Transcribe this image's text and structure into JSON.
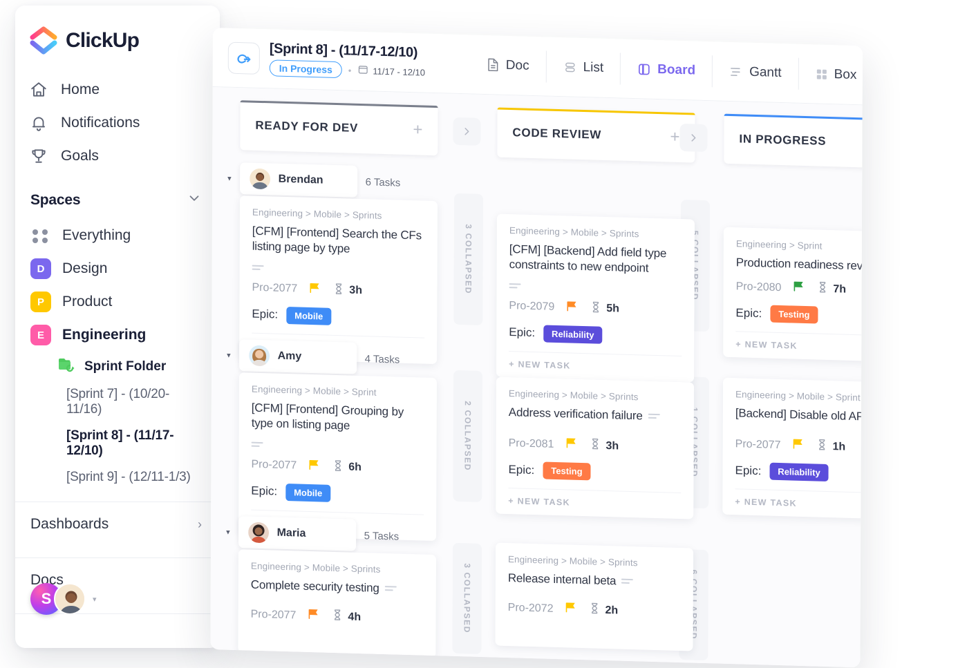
{
  "brand": {
    "name": "ClickUp",
    "accent": "#7b68ee"
  },
  "sidebar": {
    "nav": [
      {
        "label": "Home",
        "icon": "home-icon"
      },
      {
        "label": "Notifications",
        "icon": "bell-icon"
      },
      {
        "label": "Goals",
        "icon": "trophy-icon"
      }
    ],
    "spaces_title": "Spaces",
    "spaces": [
      {
        "label": "Everything",
        "badge": "",
        "color": "",
        "icon": "grid-dots-icon",
        "active": false
      },
      {
        "label": "Design",
        "badge": "D",
        "color": "#7b68ee",
        "active": false
      },
      {
        "label": "Product",
        "badge": "P",
        "color": "#ffc800",
        "active": false
      },
      {
        "label": "Engineering",
        "badge": "E",
        "color": "#ff5ca8",
        "active": true
      }
    ],
    "folder": {
      "label": "Sprint Folder",
      "icon": "folder-sprint-icon"
    },
    "sprints": [
      {
        "label": "[Sprint 7] - (10/20-11/16)",
        "active": false
      },
      {
        "label": "[Sprint 8] - (11/17-12/10)",
        "active": true
      },
      {
        "label": "[Sprint 9] - (12/11-1/3)",
        "active": false
      }
    ],
    "footer_rows": [
      {
        "label": "Dashboards",
        "chevron": "›"
      },
      {
        "label": "Docs",
        "chevron": ""
      }
    ],
    "user_dock": {
      "workspace_initial": "S",
      "caret": "▾"
    }
  },
  "header": {
    "sprint_icon": "sprint-arrow-icon",
    "title": "[Sprint 8] - (11/17-12/10)",
    "status": "In Progress",
    "separator": "•",
    "date_range": "11/17 - 12/10",
    "views": [
      {
        "label": "Doc",
        "icon": "doc-icon",
        "active": false
      },
      {
        "label": "List",
        "icon": "list-icon",
        "active": false
      },
      {
        "label": "Board",
        "icon": "board-icon",
        "active": true
      },
      {
        "label": "Gantt",
        "icon": "gantt-icon",
        "active": false
      },
      {
        "label": "Box",
        "icon": "box-icon",
        "active": false
      }
    ]
  },
  "board": {
    "columns": [
      {
        "title": "READY FOR DEV",
        "accent": "#7a7f8c",
        "plus": "+"
      },
      {
        "title": "CODE REVIEW",
        "accent": "#f7c600",
        "plus": "+"
      },
      {
        "title": "IN PROGRESS",
        "accent": "#3f8cf7",
        "plus": "+"
      }
    ],
    "collapsed_strips": [
      {
        "label": "3 COLLAPSED"
      },
      {
        "label": "5 COLLAPSED"
      },
      {
        "label": "2 COLLAPSED"
      },
      {
        "label": "1 COLLAPSED"
      },
      {
        "label": "3 COLLAPSED"
      },
      {
        "label": "6 COLLAPSED"
      }
    ],
    "chevron": "›",
    "new_task_label": "+ NEW TASK",
    "epic_label": "Epic:",
    "groups": [
      {
        "assignee": "Brendan",
        "avatar_bg": "#f5e6cf",
        "tasks_count": "6 Tasks",
        "caret": "▾",
        "cards": [
          {
            "breadcrumb": "Engineering > Mobile > Sprints",
            "title": "[CFM] [Frontend] Search the CFs listing page by type",
            "task_id": "Pro-2077",
            "priority_flag": "#ffc800",
            "hours": "3h",
            "epic": "Mobile",
            "epic_color": "#3f8cf7"
          },
          {
            "breadcrumb": "Engineering > Mobile > Sprints",
            "title": "[CFM] [Backend] Add field type constraints to new endpoint",
            "task_id": "Pro-2079",
            "priority_flag": "#ff8b26",
            "hours": "5h",
            "epic": "Reliability",
            "epic_color": "#5b4ddb"
          },
          {
            "breadcrumb": "Engineering > Sprint",
            "title": "Production readiness review",
            "task_id": "Pro-2080",
            "priority_flag": "#2ea043",
            "hours": "7h",
            "epic": "Testing",
            "epic_color": "#ff7a45"
          }
        ]
      },
      {
        "assignee": "Amy",
        "avatar_bg": "#d9eef8",
        "tasks_count": "4 Tasks",
        "caret": "▾",
        "cards": [
          {
            "breadcrumb": "Engineering > Mobile > Sprint",
            "title": "[CFM] [Frontend] Grouping by type on listing page",
            "task_id": "Pro-2077",
            "priority_flag": "#ffc800",
            "hours": "6h",
            "epic": "Mobile",
            "epic_color": "#3f8cf7"
          },
          {
            "breadcrumb": "Engineering > Mobile > Sprints",
            "title": "Address verification failure",
            "task_id": "Pro-2081",
            "priority_flag": "#ffc800",
            "hours": "3h",
            "epic": "Testing",
            "epic_color": "#ff7a45"
          },
          {
            "breadcrumb": "Engineering > Mobile > Sprint",
            "title": "[Backend] Disable old API",
            "task_id": "Pro-2077",
            "priority_flag": "#ffc800",
            "hours": "1h",
            "epic": "Reliability",
            "epic_color": "#5b4ddb"
          }
        ]
      },
      {
        "assignee": "Maria",
        "avatar_bg": "#e8d3c6",
        "tasks_count": "5 Tasks",
        "caret": "▾",
        "cards": [
          {
            "breadcrumb": "Engineering > Mobile > Sprints",
            "title": "Complete security testing",
            "task_id": "Pro-2077",
            "priority_flag": "#ff8b26",
            "hours": "4h",
            "epic": "",
            "epic_color": ""
          },
          {
            "breadcrumb": "Engineering > Mobile > Sprints",
            "title": "Release internal beta",
            "task_id": "Pro-2072",
            "priority_flag": "#ffc800",
            "hours": "2h",
            "epic": "",
            "epic_color": ""
          }
        ]
      }
    ]
  }
}
